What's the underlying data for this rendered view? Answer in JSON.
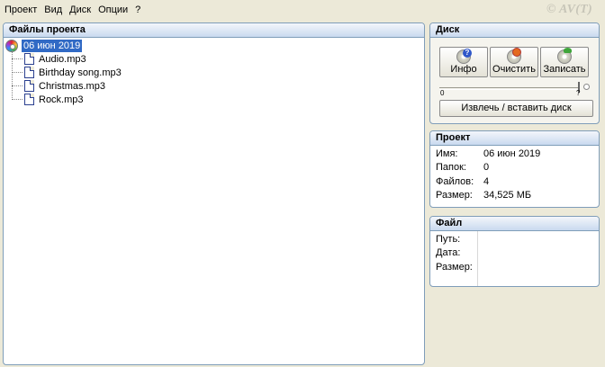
{
  "menu": {
    "items": [
      "Проект",
      "Вид",
      "Диск",
      "Опции",
      "?"
    ],
    "copyright": "© AV(T)"
  },
  "files_panel": {
    "title": "Файлы проекта",
    "root": "06 июн 2019",
    "files": [
      "Audio.mp3",
      "Birthday song.mp3",
      "Christmas.mp3",
      "Rock.mp3"
    ]
  },
  "disk_panel": {
    "title": "Диск",
    "info_label": "Инфо",
    "erase_label": "Очистить",
    "burn_label": "Записать",
    "slider_min": "0",
    "slider_max": "?",
    "eject_label": "Извлечь / вставить диск"
  },
  "project_panel": {
    "title": "Проект",
    "rows": [
      {
        "key": "Имя:",
        "value": "06 июн 2019"
      },
      {
        "key": "Папок:",
        "value": "0"
      },
      {
        "key": "Файлов:",
        "value": "4"
      },
      {
        "key": "Размер:",
        "value": "34,525 МБ"
      }
    ]
  },
  "file_panel": {
    "title": "Файл",
    "rows": [
      {
        "key": "Путь:",
        "value": ""
      },
      {
        "key": "Дата:",
        "value": ""
      },
      {
        "key": "Размер:",
        "value": ""
      }
    ]
  },
  "colors": {
    "window_bg": "#ece9d8",
    "panel_border": "#7f9db9",
    "selection": "#316ac5"
  },
  "icons": [
    "disc-icon",
    "file-icon",
    "info-icon",
    "erase-icon",
    "burn-icon"
  ]
}
